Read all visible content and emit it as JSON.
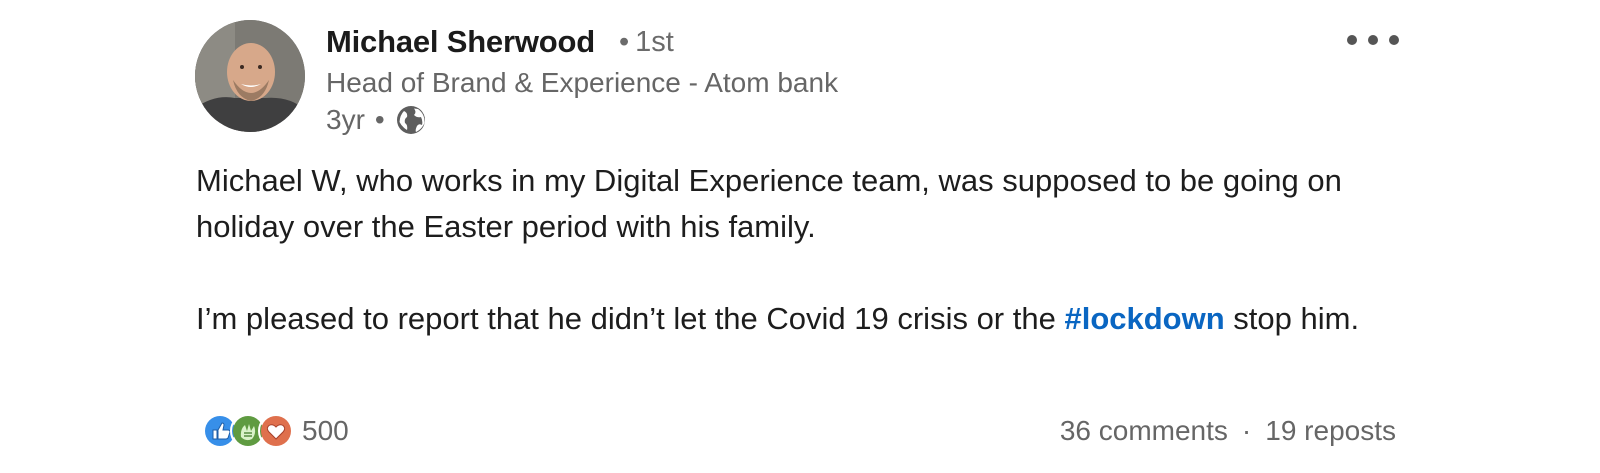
{
  "post": {
    "author": {
      "name": "Michael Sherwood",
      "degree_separator": "•",
      "degree": "1st",
      "headline": "Head of Brand & Experience - Atom bank",
      "time": "3yr",
      "time_separator": "•",
      "visibility_icon": "globe-icon"
    },
    "menu_icon": "more-horizontal-icon",
    "body": {
      "paragraph1": "Michael W, who works in my Digital Experience team, was supposed to be going on holiday over the Easter period with his family.",
      "paragraph2_before": "I’m pleased to report that he didn’t let the Covid 19 crisis or the ",
      "hashtag": "#lockdown",
      "paragraph2_after": " stop him."
    },
    "social": {
      "reaction_icons": [
        "like-icon",
        "celebrate-icon",
        "love-icon"
      ],
      "reaction_count": "500",
      "comments": "36 comments",
      "separator": "·",
      "reposts": "19 reposts"
    },
    "colors": {
      "link": "#0a66c2",
      "like": "#378fe9",
      "celebrate": "#5f9b41",
      "love": "#df704d"
    }
  }
}
